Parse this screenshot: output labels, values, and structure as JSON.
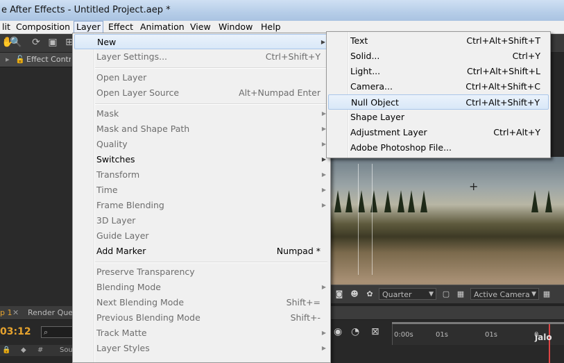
{
  "window": {
    "title": "e After Effects - Untitled Project.aep *"
  },
  "menubar": {
    "items": [
      "lit",
      "Composition",
      "Layer",
      "Effect",
      "Animation",
      "View",
      "Window",
      "Help"
    ],
    "active": "Layer"
  },
  "left_panel": {
    "effect_tab": "Effect Controls"
  },
  "layer_menu": {
    "new": "New",
    "layer_settings": "Layer Settings...",
    "layer_settings_sc": "Ctrl+Shift+Y",
    "open_layer": "Open Layer",
    "open_layer_source": "Open Layer Source",
    "open_layer_source_sc": "Alt+Numpad Enter",
    "mask": "Mask",
    "mask_shape_path": "Mask and Shape Path",
    "quality": "Quality",
    "switches": "Switches",
    "transform": "Transform",
    "time": "Time",
    "frame_blending": "Frame Blending",
    "layer_3d": "3D Layer",
    "guide_layer": "Guide Layer",
    "add_marker": "Add Marker",
    "add_marker_sc": "Numpad *",
    "preserve_transparency": "Preserve Transparency",
    "blending_mode": "Blending Mode",
    "next_blending_mode": "Next Blending Mode",
    "next_blending_mode_sc": "Shift+=",
    "prev_blending_mode": "Previous Blending Mode",
    "prev_blending_mode_sc": "Shift+-",
    "track_matte": "Track Matte",
    "layer_styles": "Layer Styles"
  },
  "new_menu": {
    "text": "Text",
    "text_sc": "Ctrl+Alt+Shift+T",
    "solid": "Solid...",
    "solid_sc": "Ctrl+Y",
    "light": "Light...",
    "light_sc": "Ctrl+Alt+Shift+L",
    "camera": "Camera...",
    "camera_sc": "Ctrl+Alt+Shift+C",
    "null_object": "Null Object",
    "null_object_sc": "Ctrl+Alt+Shift+Y",
    "shape_layer": "Shape Layer",
    "adjustment_layer": "Adjustment Layer",
    "adjustment_layer_sc": "Ctrl+Alt+Y",
    "photoshop_file": "Adobe Photoshop File..."
  },
  "comp_toolbar": {
    "resolution": "Quarter",
    "view": "Active Camera"
  },
  "timeline": {
    "tab_comp": "p 1",
    "tab_render": "Render Queue",
    "timecode": "03:12",
    "search_placeholder": "",
    "col_source": "Sou",
    "col_hash": "#",
    "ruler": [
      "0:00s",
      "01s",
      "01s",
      "0"
    ]
  },
  "watermark": "jalo",
  "colors": {
    "timecode": "#e6a32e",
    "menu_bg": "#f0f0f0",
    "highlight": "#d9e8f8",
    "panel": "#262626"
  }
}
